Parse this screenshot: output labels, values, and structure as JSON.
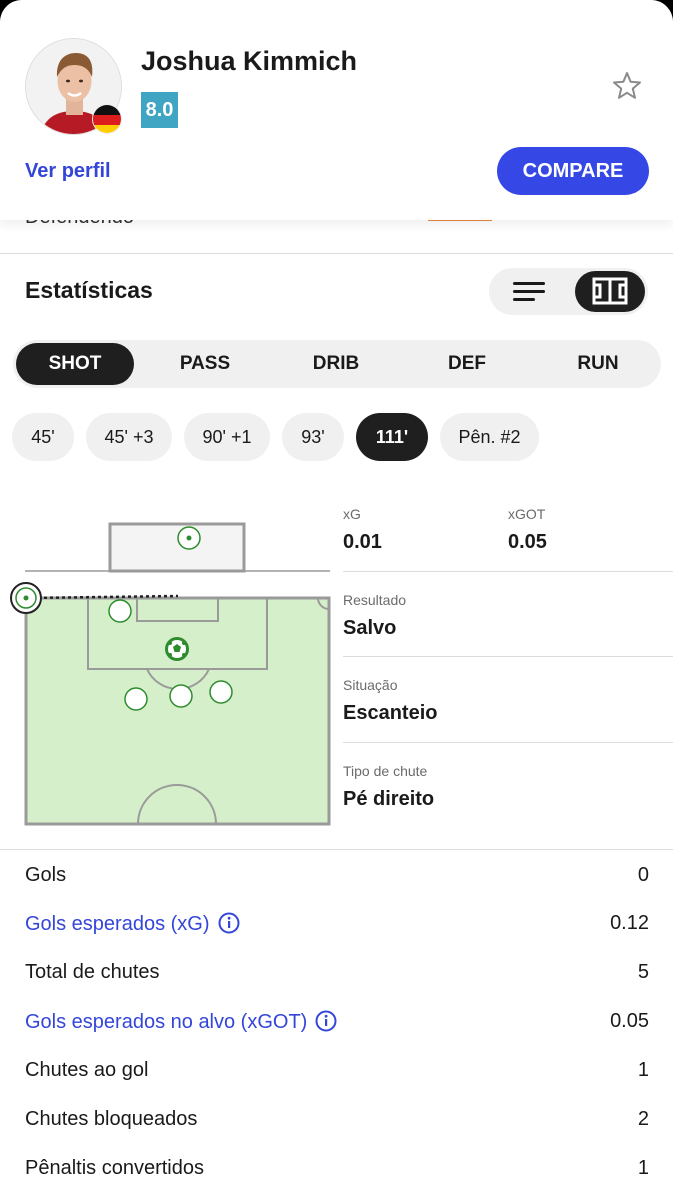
{
  "player": {
    "name": "Joshua Kimmich",
    "rating": "8.0",
    "profile_link": "Ver perfil",
    "compare_label": "COMPARE"
  },
  "peek_text": "Defendendo",
  "stats": {
    "title": "Estatísticas",
    "tabs": [
      {
        "label": "SHOT",
        "active": true
      },
      {
        "label": "PASS",
        "active": false
      },
      {
        "label": "DRIB",
        "active": false
      },
      {
        "label": "DEF",
        "active": false
      },
      {
        "label": "RUN",
        "active": false
      }
    ],
    "chips": [
      {
        "label": "45'",
        "active": false
      },
      {
        "label": "45' +3",
        "active": false
      },
      {
        "label": "90' +1",
        "active": false
      },
      {
        "label": "93'",
        "active": false
      },
      {
        "label": "111'",
        "active": true
      },
      {
        "label": "Pên. #2",
        "active": false
      }
    ]
  },
  "shot": {
    "xg_label": "xG",
    "xg_value": "0.01",
    "xgot_label": "xGOT",
    "xgot_value": "0.05",
    "result_label": "Resultado",
    "result_value": "Salvo",
    "situation_label": "Situação",
    "situation_value": "Escanteio",
    "type_label": "Tipo de chute",
    "type_value": "Pé direito"
  },
  "summary": [
    {
      "label": "Gols",
      "value": "0",
      "link": false
    },
    {
      "label": "Gols esperados (xG)",
      "value": "0.12",
      "link": true
    },
    {
      "label": "Total de chutes",
      "value": "5",
      "link": false
    },
    {
      "label": "Gols esperados no alvo (xGOT)",
      "value": "0.05",
      "link": true
    },
    {
      "label": "Chutes ao gol",
      "value": "1",
      "link": false
    },
    {
      "label": "Chutes bloqueados",
      "value": "2",
      "link": false
    },
    {
      "label": "Pênaltis convertidos",
      "value": "1",
      "link": false
    }
  ],
  "colors": {
    "accent": "#3548e6",
    "link": "#3446d9",
    "rating": "#3fa5c2",
    "pitch": "#d4efc9",
    "marker": "#2e8b2e"
  }
}
